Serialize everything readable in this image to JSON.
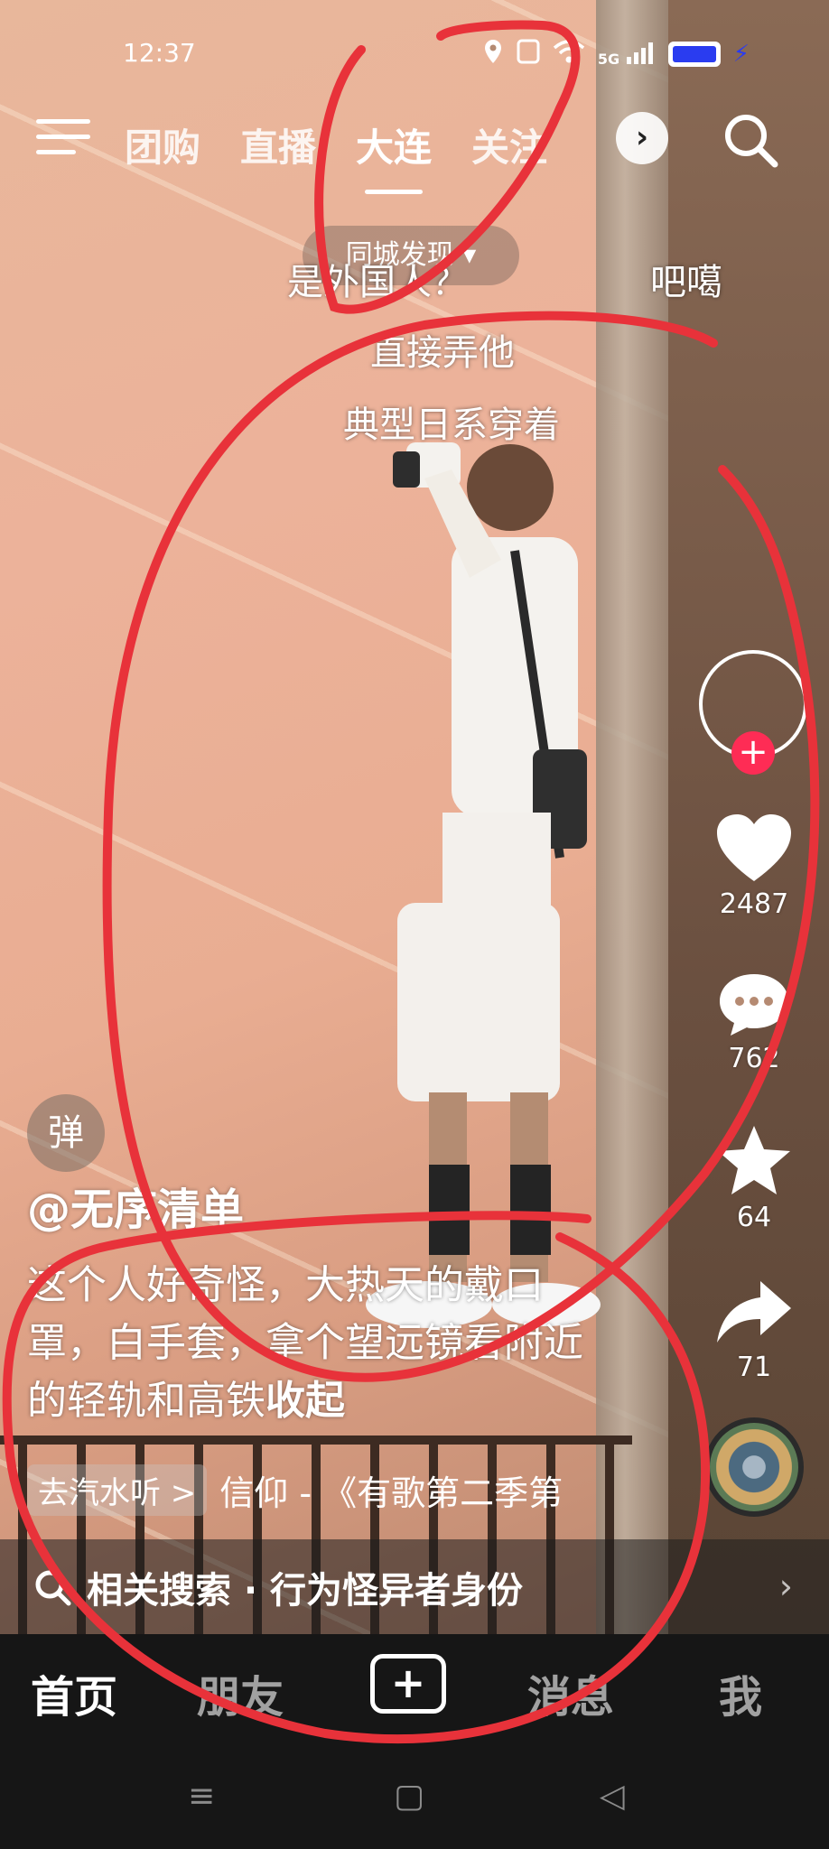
{
  "status_bar": {
    "time": "12:37",
    "network": "5G"
  },
  "top_nav": {
    "tabs": [
      {
        "label": "团购",
        "active": false
      },
      {
        "label": "直播",
        "active": false
      },
      {
        "label": "大连",
        "active": true
      },
      {
        "label": "关注",
        "active": false
      }
    ]
  },
  "local_pill": {
    "label": "同城发现"
  },
  "danmu": {
    "d1": "是外国人？",
    "d2": "吧噶",
    "d3": "直接弄他",
    "d4": "典型日系穿着"
  },
  "side_actions": {
    "likes": "2487",
    "comments": "762",
    "favorites": "64",
    "shares": "71"
  },
  "video_info": {
    "danmu_toggle": "弹",
    "author": "@无序清单",
    "caption": "这个人好奇怪，大热天的戴口罩，白手套，拿个望远镜看附近的轻轨和高铁",
    "collapse_label": "收起",
    "music_chip": "去汽水听 >",
    "music_title": "信仰 - 《有歌第二季第"
  },
  "related_search": {
    "text": "相关搜索 · 行为怪异者身份"
  },
  "bottom_tabs": {
    "home": "首页",
    "friends": "朋友",
    "plus": "+",
    "messages": "消息",
    "me": "我"
  },
  "colors": {
    "accent": "#fe2c55",
    "annotation": "#e8323a"
  }
}
